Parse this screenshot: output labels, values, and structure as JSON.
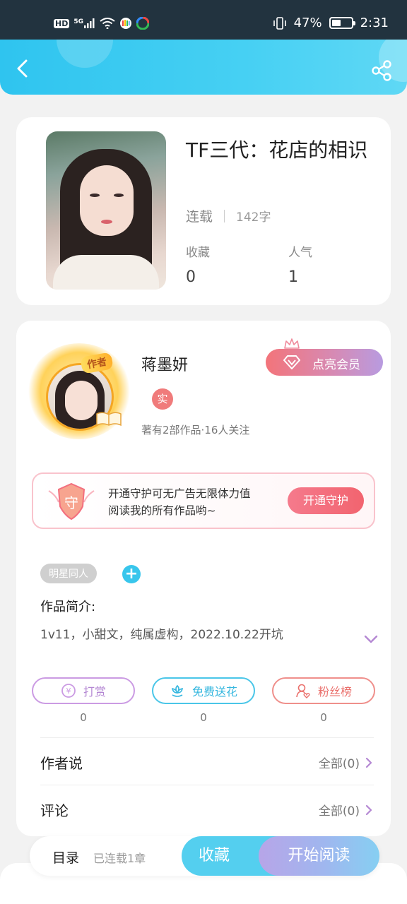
{
  "status_bar": {
    "left_icons": [
      "hd-icon",
      "signal-5g-icon",
      "wifi-icon",
      "app-icon-1",
      "app-icon-2"
    ],
    "hd": "HD",
    "net": "5G",
    "battery_percent": "47%",
    "battery_level": 0.47,
    "time": "2:31"
  },
  "header": {
    "back_icon": "chevron-left-icon",
    "share_icon": "share-icon",
    "accent": "#2fc4ef"
  },
  "book": {
    "title": "TF三代：花店的相识",
    "status": "连载",
    "word_count": "142字",
    "favorites_label": "收藏",
    "favorites_value": "0",
    "popularity_label": "人气",
    "popularity_value": "1"
  },
  "author": {
    "badge": "作者",
    "name": "蒋墨妍",
    "real_tag": "实",
    "summary": "著有2部作品·16人关注",
    "vip_button": "点亮会员"
  },
  "guard": {
    "shield_char": "守",
    "text_line1": "开通守护可无广告无限体力值",
    "text_line2": "阅读我的所有作品哟~",
    "button": "开通守护"
  },
  "tags": {
    "chip": "明星同人",
    "add": "+"
  },
  "intro": {
    "label": "作品简介:",
    "text": "1v11，小甜文，纯属虚构，2022.10.22开坑"
  },
  "actions": [
    {
      "label": "打赏",
      "count": "0",
      "icon": "coin-icon",
      "color": "#b487d3"
    },
    {
      "label": "免费送花",
      "count": "0",
      "icon": "flower-icon",
      "color": "#36b7df"
    },
    {
      "label": "粉丝榜",
      "count": "0",
      "icon": "fans-icon",
      "color": "#ea6f6b"
    }
  ],
  "rows": [
    {
      "label": "作者说",
      "right": "全部(0)"
    },
    {
      "label": "评论",
      "right": "全部(0)"
    }
  ],
  "bottom": {
    "toc": "目录",
    "toc_sub": "已连载1章",
    "favorite": "收藏",
    "read": "开始阅读"
  }
}
